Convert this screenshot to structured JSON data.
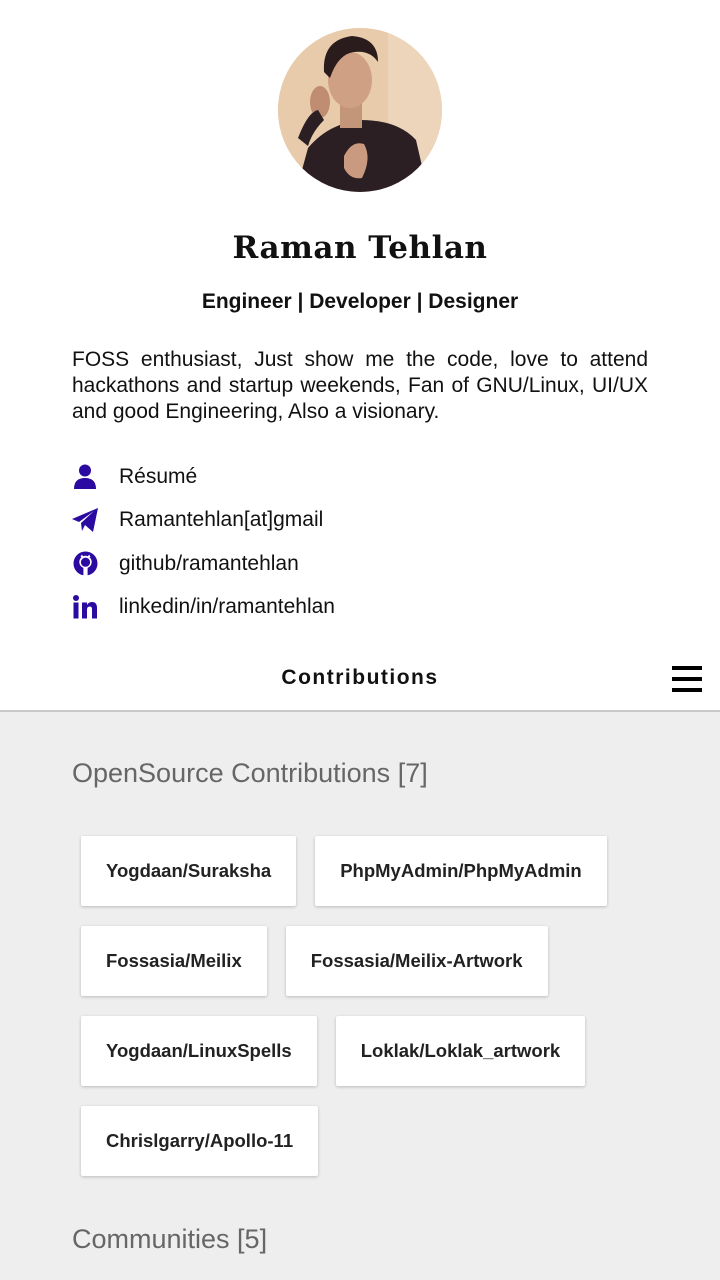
{
  "profile": {
    "name": "Raman Tehlan",
    "tagline": "Engineer | Developer | Designer",
    "bio": "FOSS enthusiast, Just show me the code, love to attend hackathons and startup weekends, Fan of GNU/Linux, UI/UX and good Engineering, Also a visionary.",
    "accent_color": "#2a0aa0"
  },
  "links": [
    {
      "icon": "user-icon",
      "label": "Résumé"
    },
    {
      "icon": "paper-plane-icon",
      "label": "Ramantehlan[at]gmail"
    },
    {
      "icon": "github-icon",
      "label": "github/ramantehlan"
    },
    {
      "icon": "linkedin-icon",
      "label": "linkedin/in/ramantehlan"
    }
  ],
  "navbar": {
    "title": "Contributions",
    "menu_icon": "hamburger-menu-icon"
  },
  "opensource": {
    "title": "OpenSource Contributions [7]",
    "items": [
      "Yogdaan/Suraksha",
      "PhpMyAdmin/PhpMyAdmin",
      "Fossasia/Meilix",
      "Fossasia/Meilix-Artwork",
      "Yogdaan/LinuxSpells",
      "Loklak/Loklak_artwork",
      "Chrislgarry/Apollo-11"
    ]
  },
  "communities": {
    "title": "Communities [5]"
  }
}
